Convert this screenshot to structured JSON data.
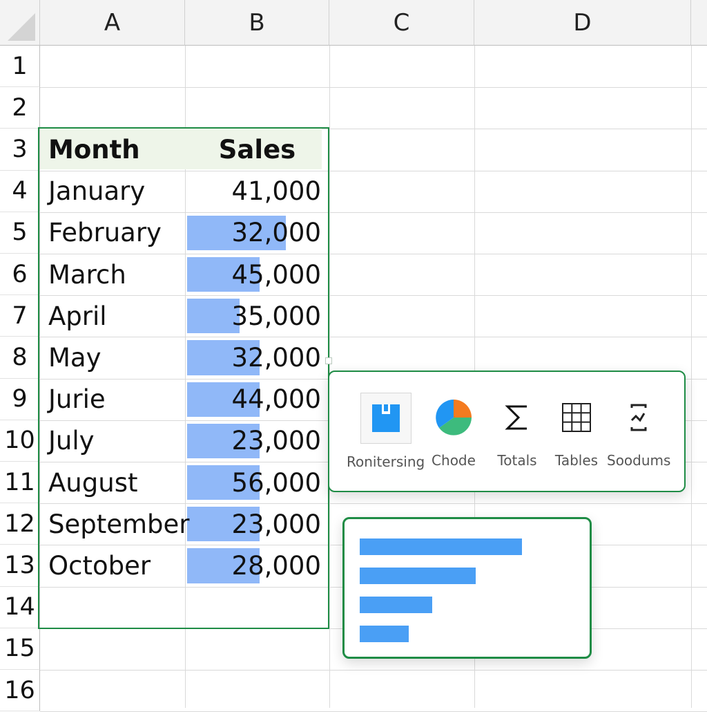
{
  "columns": [
    "A",
    "B",
    "C",
    "D"
  ],
  "rows": [
    "1",
    "2",
    "3",
    "4",
    "5",
    "6",
    "7",
    "8",
    "9",
    "10",
    "11",
    "12",
    "13",
    "14",
    "15",
    "16"
  ],
  "table": {
    "headers": [
      "Month",
      "Sales"
    ],
    "rows": [
      {
        "month": "January",
        "sales": "41,000",
        "bar_fraction": 0
      },
      {
        "month": "February",
        "sales": "32,000",
        "bar_fraction": 0.75
      },
      {
        "month": "March",
        "sales": "45,000",
        "bar_fraction": 0.55
      },
      {
        "month": "April",
        "sales": "35,000",
        "bar_fraction": 0.4
      },
      {
        "month": "May",
        "sales": "32,000",
        "bar_fraction": 0.55
      },
      {
        "month": "Jurie",
        "sales": "44,000",
        "bar_fraction": 0.55
      },
      {
        "month": "July",
        "sales": "23,000",
        "bar_fraction": 0.55
      },
      {
        "month": "August",
        "sales": "56,000",
        "bar_fraction": 0.55
      },
      {
        "month": "September",
        "sales": "23,000",
        "bar_fraction": 0.55
      },
      {
        "month": "October",
        "sales": "28,000",
        "bar_fraction": 0.55
      }
    ]
  },
  "quick_analysis": {
    "options": [
      {
        "label": "Ronitersing",
        "icon": "formatting-icon"
      },
      {
        "label": "Chode",
        "icon": "pie-chart-icon"
      },
      {
        "label": "Totals",
        "icon": "sigma-icon"
      },
      {
        "label": "Tables",
        "icon": "table-grid-icon"
      },
      {
        "label": "Soodums",
        "icon": "sparklines-icon"
      }
    ]
  },
  "preview": {
    "type": "bar",
    "bar_fractions": [
      0.56,
      0.4,
      0.25,
      0.17
    ]
  },
  "colors": {
    "selection": "#1e8c45",
    "data_bar": "#8ab4f8",
    "header_fill": "#eef5e9",
    "accent_blue": "#2196f3",
    "pie_blue": "#2196f3",
    "pie_orange": "#f47b20",
    "pie_green": "#3dbb7d"
  }
}
